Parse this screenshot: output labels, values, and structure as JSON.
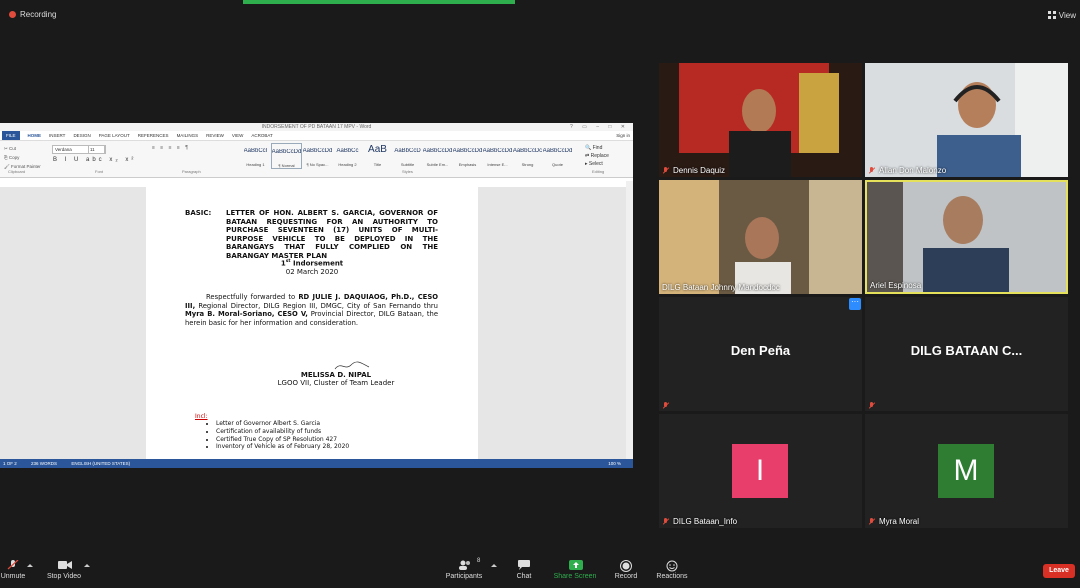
{
  "top_bar": {
    "recording_label": "Recording",
    "view_label": "View"
  },
  "word": {
    "title": "INDORSEMENT OF PD BATAAN 17 MPV - Word",
    "tabs": [
      "FILE",
      "HOME",
      "INSERT",
      "DESIGN",
      "PAGE LAYOUT",
      "REFERENCES",
      "MAILINGS",
      "REVIEW",
      "VIEW",
      "ACROBAT"
    ],
    "sign_in": "Sign in",
    "clipboard": {
      "cut": "Cut",
      "copy": "Copy",
      "format_painter": "Format Painter"
    },
    "font_name": "Verdana",
    "font_size": "11",
    "format_buttons": "B I U abc x₂ x²",
    "paragraph_buttons": "≡ ≡ ≡ ≡ ¶",
    "styles": [
      {
        "sample": "AaBbCcI",
        "label": "Heading 1"
      },
      {
        "sample": "AaBbCcDd",
        "label": "¶ Normal"
      },
      {
        "sample": "AaBbCcDd",
        "label": "¶ No Spac..."
      },
      {
        "sample": "AaBbCc",
        "label": "Heading 2"
      },
      {
        "sample": "AaB",
        "label": "Title"
      },
      {
        "sample": "AaBbCcD",
        "label": "Subtitle"
      },
      {
        "sample": "AaBbCcDd",
        "label": "Subtle Em..."
      },
      {
        "sample": "AaBbCcDd",
        "label": "Emphasis"
      },
      {
        "sample": "AaBbCcDd",
        "label": "Intense E..."
      },
      {
        "sample": "AaBbCcDc",
        "label": "Strong"
      },
      {
        "sample": "AaBbCcDd",
        "label": "Quote"
      }
    ],
    "editing": {
      "find": "Find",
      "replace": "Replace",
      "select": "Select"
    },
    "groups": {
      "clipboard": "Clipboard",
      "font": "Font",
      "paragraph": "Paragraph",
      "styles": "Styles",
      "editing": "Editing"
    },
    "doc": {
      "basic_label": "BASIC:",
      "basic_text": "LETTER OF HON. ALBERT S. GARCIA, GOVERNOR OF BATAAN REQUESTING FOR AN AUTHORITY TO PURCHASE SEVENTEEN (17) UNITS OF MULTI-PURPOSE VEHICLE TO BE DEPLOYED IN THE BARANGAYS THAT FULLY COMPLIED ON THE BARANGAY MASTER PLAN",
      "endorsement_num": "1",
      "endorsement_sup": "st",
      "endorsement_word": " Indorsement",
      "date": "02 March 2020",
      "para_1": "Respectfully forwarded to ",
      "para_2": "RD JULIE J. DAQUIAOG, Ph.D., CESO III,",
      "para_3": " Regional Director, DILG Region III, DMGC, City of San Fernando thru ",
      "para_4": "Myra B. Moral-Soriano, CESO V,",
      "para_5": " Provincial Director, DILG Bataan, the herein basic for her information and consideration.",
      "signatory_name": "MELISSA D. NIPAL",
      "signatory_title": "LGOO VII, Cluster of Team Leader",
      "incl_label": "Incl:",
      "inclusions": [
        "Letter of Governor Albert S. Garcia",
        "Certification of availability of funds",
        "Certified True Copy of SP Resolution 427",
        "Inventory of Vehicle as of February 28, 2020"
      ]
    },
    "status": {
      "page": "1 OF 2",
      "words": "236 WORDS",
      "language": "ENGLISH (UNITED STATES)",
      "zoom": "100 %"
    }
  },
  "participants": [
    {
      "name": "Dennis Daquiz",
      "type": "video",
      "muted": true
    },
    {
      "name": "Allan Don Malonzo",
      "type": "video",
      "muted": true
    },
    {
      "name": "DILG Bataan Johnny Mandocdoc",
      "type": "video",
      "muted": false
    },
    {
      "name": "Ariel Espinosa",
      "type": "video",
      "muted": false,
      "active": true
    },
    {
      "name": "Den Peña",
      "type": "name",
      "muted": true
    },
    {
      "name": "DILG BATAAN C...",
      "type": "name",
      "muted": true
    },
    {
      "name": "DILG Bataan_Info",
      "type": "avatar",
      "initial": "I",
      "color": "#e83e6c",
      "muted": true
    },
    {
      "name": "Myra Moral",
      "type": "avatar",
      "initial": "M",
      "color": "#2e7d32",
      "muted": true
    }
  ],
  "toolbar": {
    "unmute": "Unmute",
    "stop_video": "Stop Video",
    "participants": "Participants",
    "participants_count": "8",
    "chat": "Chat",
    "share_screen": "Share Screen",
    "record": "Record",
    "reactions": "Reactions",
    "leave": "Leave"
  },
  "colors": {
    "word_blue": "#2b579a",
    "share_green": "#2fae4e",
    "leave_red": "#d93025",
    "active_border": "#e6e15a"
  }
}
